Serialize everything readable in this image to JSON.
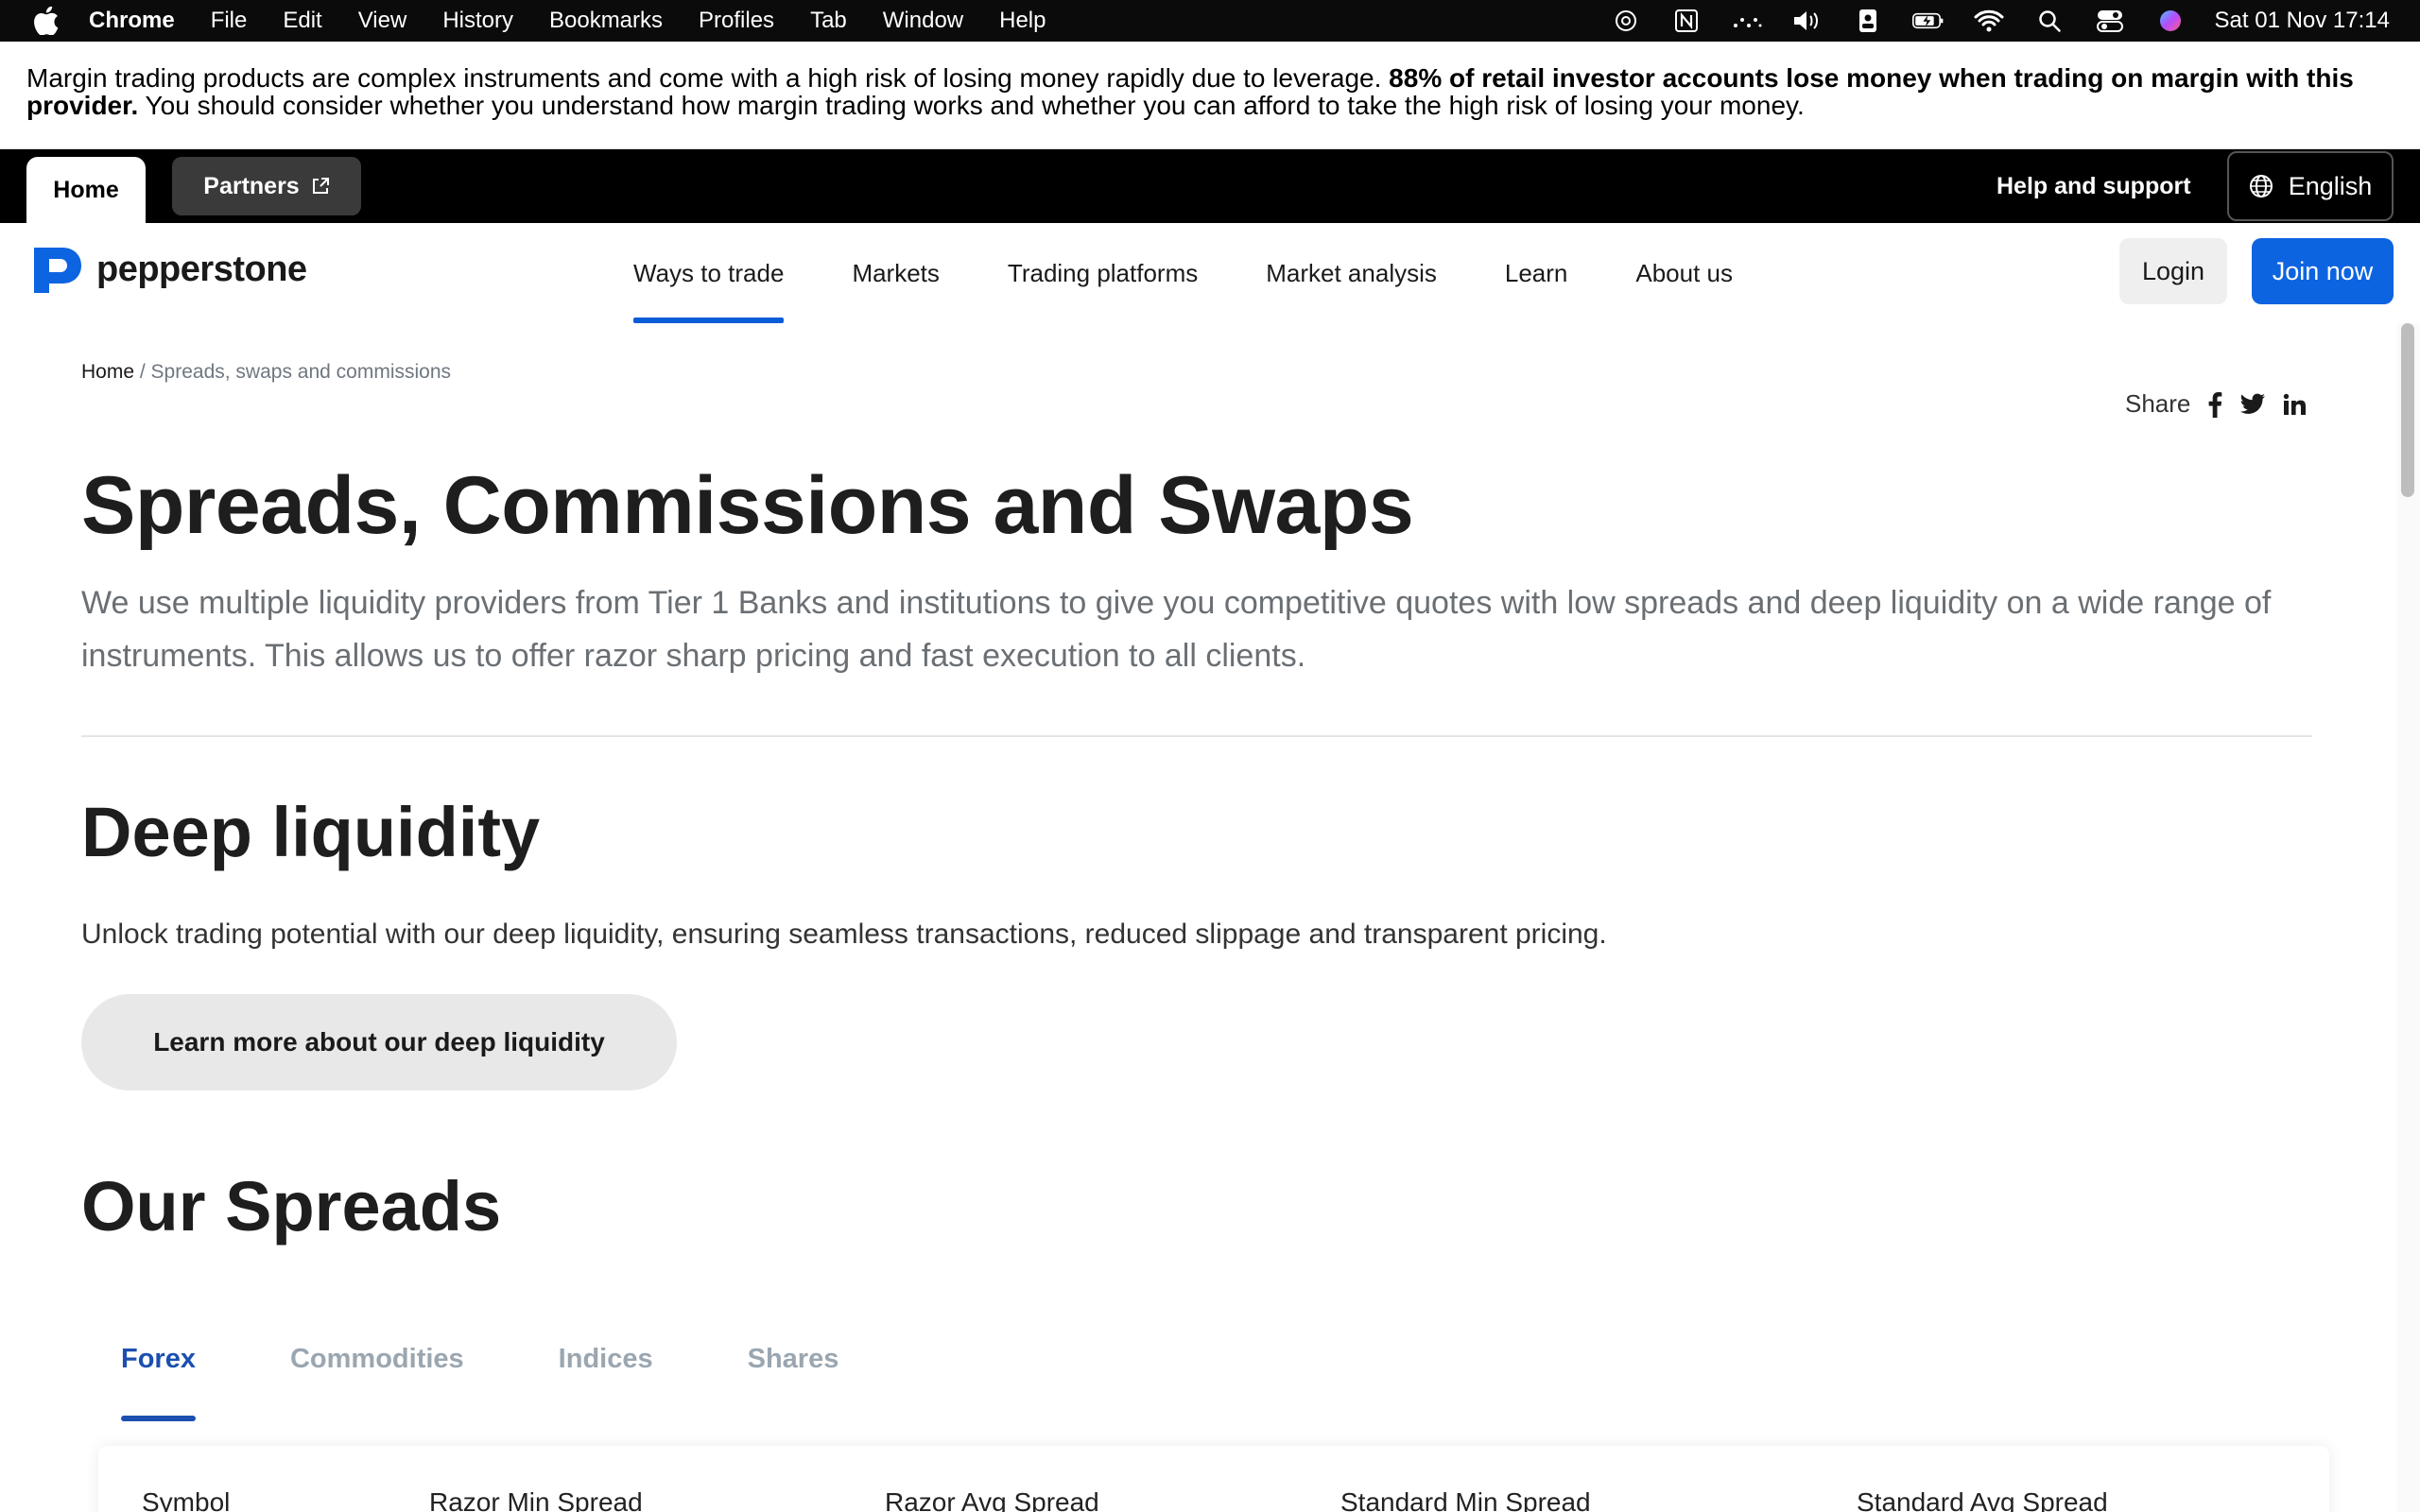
{
  "menubar": {
    "app": "Chrome",
    "items": [
      "File",
      "Edit",
      "View",
      "History",
      "Bookmarks",
      "Profiles",
      "Tab",
      "Window",
      "Help"
    ],
    "clock": "Sat 01 Nov  17:14"
  },
  "risk": {
    "text1": "Margin trading products are complex instruments and come with a high risk of losing money rapidly due to leverage. ",
    "bold": "88% of retail investor accounts lose money when trading on margin with this provider.",
    "text2": " You should consider whether you understand how margin trading works and whether you can afford to take the high risk of losing your money."
  },
  "topbar": {
    "home": "Home",
    "partners": "Partners",
    "help": "Help and support",
    "language": "English"
  },
  "nav": {
    "brand": "pepperstone",
    "links": [
      "Ways to trade",
      "Markets",
      "Trading platforms",
      "Market analysis",
      "Learn",
      "About us"
    ],
    "login": "Login",
    "join": "Join now"
  },
  "breadcrumb": {
    "home": "Home",
    "sep": " / ",
    "current": "Spreads, swaps and commissions"
  },
  "share": {
    "label": "Share"
  },
  "hero": {
    "title": "Spreads, Commissions and Swaps",
    "lead": "We use multiple liquidity providers from Tier 1 Banks and institutions to give you competitive quotes with low spreads and deep liquidity on a wide range of instruments. This allows us to offer razor sharp pricing and fast execution to all clients."
  },
  "liquidity": {
    "title": "Deep liquidity",
    "text": "Unlock trading potential with our deep liquidity, ensuring seamless transactions, reduced slippage and transparent pricing.",
    "button": "Learn more about our deep liquidity"
  },
  "spreads": {
    "title": "Our Spreads",
    "tabs": [
      "Forex",
      "Commodities",
      "Indices",
      "Shares"
    ],
    "columns": [
      "Symbol",
      "Razor Min Spread",
      "Razor Avg Spread",
      "Standard Min Spread",
      "Standard Avg Spread"
    ]
  },
  "colors": {
    "accent": "#0d64e0",
    "tab_active": "#1b4fb0",
    "tab_inactive": "#9aa6b0"
  }
}
